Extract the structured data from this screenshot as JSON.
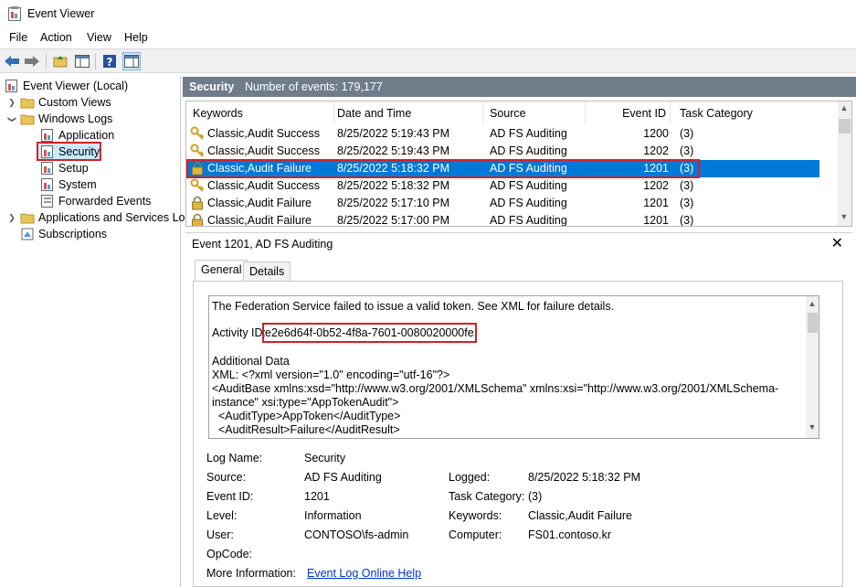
{
  "window": {
    "title": "Event Viewer"
  },
  "menu": [
    "File",
    "Action",
    "View",
    "Help"
  ],
  "tree": {
    "root": "Event Viewer (Local)",
    "custom_views": "Custom Views",
    "windows_logs": "Windows Logs",
    "logs": [
      "Application",
      "Security",
      "Setup",
      "System",
      "Forwarded Events"
    ],
    "apps_services": "Applications and Services Lo",
    "subscriptions": "Subscriptions"
  },
  "header": {
    "title": "Security",
    "count": "Number of events: 179,177"
  },
  "columns": [
    "Keywords",
    "Date and Time",
    "Source",
    "Event ID",
    "Task Category"
  ],
  "events": [
    {
      "keywords": "Classic,Audit Success",
      "date": "8/25/2022 5:19:43 PM",
      "source": "AD FS Auditing",
      "id": "1200",
      "category": "(3)",
      "type": "success"
    },
    {
      "keywords": "Classic,Audit Success",
      "date": "8/25/2022 5:19:43 PM",
      "source": "AD FS Auditing",
      "id": "1202",
      "category": "(3)",
      "type": "success"
    },
    {
      "keywords": "Classic,Audit Failure",
      "date": "8/25/2022 5:18:32 PM",
      "source": "AD FS Auditing",
      "id": "1201",
      "category": "(3)",
      "type": "failure"
    },
    {
      "keywords": "Classic,Audit Success",
      "date": "8/25/2022 5:18:32 PM",
      "source": "AD FS Auditing",
      "id": "1202",
      "category": "(3)",
      "type": "success"
    },
    {
      "keywords": "Classic,Audit Failure",
      "date": "8/25/2022 5:17:10 PM",
      "source": "AD FS Auditing",
      "id": "1201",
      "category": "(3)",
      "type": "failure"
    },
    {
      "keywords": "Classic,Audit Failure",
      "date": "8/25/2022 5:17:00 PM",
      "source": "AD FS Auditing",
      "id": "1201",
      "category": "(3)",
      "type": "failure"
    }
  ],
  "detail": {
    "title": "Event 1201, AD FS Auditing",
    "tabs": [
      "General",
      "Details"
    ],
    "description": {
      "line1": "The Federation Service failed to issue a valid token. See XML for failure details.",
      "activity_label": "Activity ID:",
      "activity_id": "e2e6d64f-0b52-4f8a-7601-0080020000fe",
      "additional": "Additional Data",
      "xml1": "XML: <?xml version=\"1.0\" encoding=\"utf-16\"?>",
      "xml2": "<AuditBase xmlns:xsd=\"http://www.w3.org/2001/XMLSchema\" xmlns:xsi=\"http://www.w3.org/2001/XMLSchema-",
      "xml3": "instance\" xsi:type=\"AppTokenAudit\">",
      "xml4": "  <AuditType>AppToken</AuditType>",
      "xml5": "  <AuditResult>Failure</AuditResult>"
    },
    "props": {
      "log_name_label": "Log Name:",
      "log_name": "Security",
      "source_label": "Source:",
      "source": "AD FS Auditing",
      "logged_label": "Logged:",
      "logged": "8/25/2022 5:18:32 PM",
      "event_id_label": "Event ID:",
      "event_id": "1201",
      "task_label": "Task Category:",
      "task": "(3)",
      "level_label": "Level:",
      "level": "Information",
      "keywords_label": "Keywords:",
      "keywords": "Classic,Audit Failure",
      "user_label": "User:",
      "user": "CONTOSO\\fs-admin",
      "computer_label": "Computer:",
      "computer": "FS01.contoso.kr",
      "opcode_label": "OpCode:",
      "more_label": "More Information:",
      "more_link": "Event Log Online Help"
    }
  },
  "colors": {
    "accent": "#0078d7",
    "highlight": "#d22028",
    "header": "#6f7d8a"
  }
}
